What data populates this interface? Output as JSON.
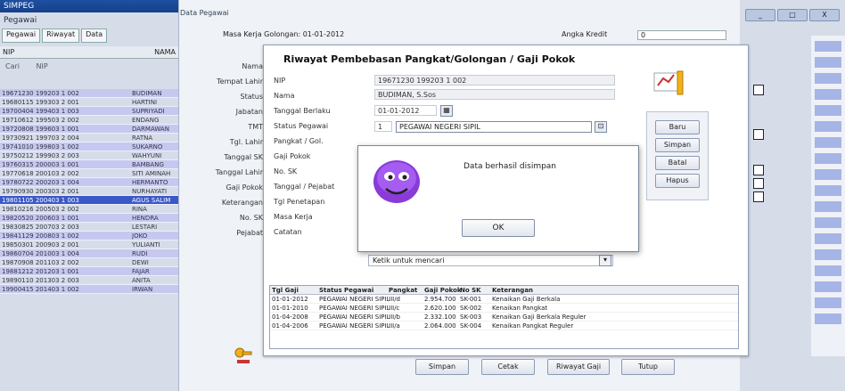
{
  "window": {
    "title": "Riwayat Pembebasan Pangkat/Golongan",
    "controls": [
      "_",
      "□",
      "X"
    ]
  },
  "background_app": {
    "title": "SIMPEG",
    "subtitle": "Pegawai",
    "tabs": [
      "Pegawai",
      "Riwayat",
      "Data"
    ],
    "list_header": [
      "NIP",
      "NAMA"
    ],
    "filter_label": "Cari",
    "filter_value": "NIP",
    "rows": [
      {
        "nip": "19671230 199203 1 002",
        "nama": "BUDIMAN"
      },
      {
        "nip": "19680115 199303 2 001",
        "nama": "HARTINI"
      },
      {
        "nip": "19700404 199403 1 003",
        "nama": "SUPRIYADI"
      },
      {
        "nip": "19710612 199503 2 002",
        "nama": "ENDANG"
      },
      {
        "nip": "19720808 199603 1 001",
        "nama": "DARMAWAN"
      },
      {
        "nip": "19730921 199703 2 004",
        "nama": "RATNA"
      },
      {
        "nip": "19741010 199803 1 002",
        "nama": "SUKARNO"
      },
      {
        "nip": "19750212 199903 2 003",
        "nama": "WAHYUNI"
      },
      {
        "nip": "19760315 200003 1 001",
        "nama": "BAMBANG"
      },
      {
        "nip": "19770618 200103 2 002",
        "nama": "SITI AMINAH"
      },
      {
        "nip": "19780722 200203 1 004",
        "nama": "HERMANTO"
      },
      {
        "nip": "19790930 200303 2 001",
        "nama": "NURHAYATI"
      },
      {
        "nip": "19801105 200403 1 003",
        "nama": "AGUS SALIM"
      },
      {
        "nip": "19810216 200503 2 002",
        "nama": "RINA"
      },
      {
        "nip": "19820520 200603 1 001",
        "nama": "HENDRA"
      },
      {
        "nip": "19830825 200703 2 003",
        "nama": "LESTARI"
      },
      {
        "nip": "19841129 200803 1 002",
        "nama": "JOKO"
      },
      {
        "nip": "19850301 200903 2 001",
        "nama": "YULIANTI"
      },
      {
        "nip": "19860704 201003 1 004",
        "nama": "RUDI"
      },
      {
        "nip": "19870908 201103 2 002",
        "nama": "DEWI"
      },
      {
        "nip": "19881212 201203 1 001",
        "nama": "FAJAR"
      },
      {
        "nip": "19890110 201303 2 003",
        "nama": "ANITA"
      },
      {
        "nip": "19900415 201403 1 002",
        "nama": "IRWAN"
      }
    ]
  },
  "middle_panel": {
    "title": "Data Pegawai",
    "top_label": "Masa Kerja Golongan: 01-01-2012",
    "top_right_label": "Angka Kredit",
    "top_right_value": "0",
    "side_labels": [
      "Nama",
      "Tempat Lahir",
      "Status",
      "Jabatan",
      "TMT",
      "Tgl. Lahir",
      "Tanggal SK",
      "Tanggal Lahir",
      "Gaji Pokok",
      "Keterangan",
      "No. SK",
      "Pejabat"
    ]
  },
  "form": {
    "title": "Riwayat Pembebasan Pangkat/Golongan / Gaji Pokok",
    "labels": [
      "NIP",
      "Nama",
      "Tanggal Berlaku",
      "Status Pegawai",
      "Pangkat / Gol.",
      "Gaji Pokok",
      "No. SK",
      "Tanggal / Pejabat",
      "Tgl Penetapan",
      "Masa Kerja",
      "Catatan"
    ],
    "nip": "19671230 199203 1 002",
    "nama": "BUDIMAN, S.Sos",
    "tanggal": "01-01-2012",
    "status_code": "1",
    "status_value": "PEGAWAI NEGERI SIPIL",
    "filter_placeholder": "Ketik untuk mencari",
    "side_buttons": [
      "Baru",
      "Simpan",
      "Batal",
      "Hapus"
    ]
  },
  "dialog": {
    "message": "Data berhasil disimpan",
    "ok_label": "OK"
  },
  "table": {
    "headers": [
      "Tgl Gaji",
      "Status Pegawai",
      "Pangkat",
      "Gaji Pokok",
      "No SK",
      "Keterangan"
    ],
    "rows": [
      [
        "01-01-2012",
        "PEGAWAI NEGERI SIPIL",
        "III/d",
        "2.954.700",
        "SK-001",
        "Kenaikan Gaji Berkala"
      ],
      [
        "01-01-2010",
        "PEGAWAI NEGERI SIPIL",
        "III/c",
        "2.620.100",
        "SK-002",
        "Kenaikan Pangkat"
      ],
      [
        "01-04-2008",
        "PEGAWAI NEGERI SIPIL",
        "III/b",
        "2.332.100",
        "SK-003",
        "Kenaikan Gaji Berkala Reguler"
      ],
      [
        "01-04-2006",
        "PEGAWAI NEGERI SIPIL",
        "III/a",
        "2.064.000",
        "SK-004",
        "Kenaikan Pangkat Reguler"
      ]
    ]
  },
  "footer_buttons": [
    "Simpan",
    "Cetak",
    "Riwayat Gaji",
    "Tutup"
  ],
  "colors": {
    "accent": "#3a58c8",
    "row_alt": "#c6c8ef",
    "title_bar": "#1d4fa1"
  }
}
